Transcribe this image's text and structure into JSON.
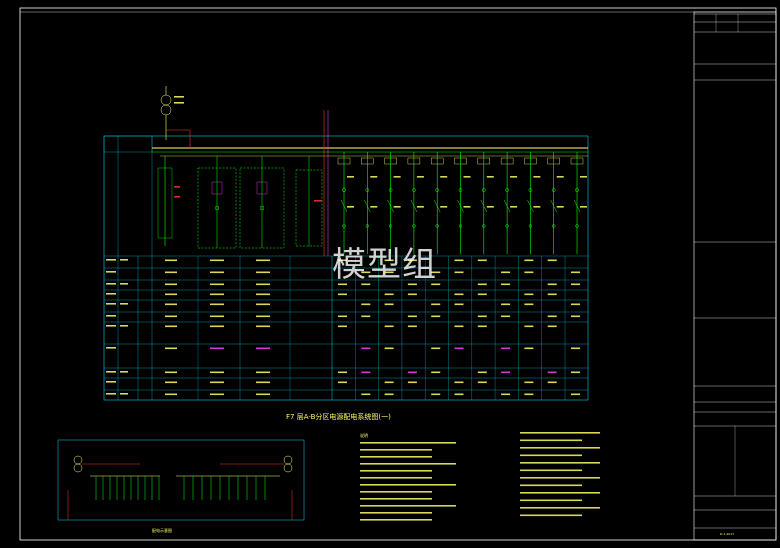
{
  "watermark": "模型组",
  "drawing": {
    "title": "F7 层A-B分区电源配电系统图(一)",
    "inset_caption": "配电示意图",
    "notes_heading": "说明"
  },
  "colors": {
    "background": "#000000",
    "table_lines": "#00b4c8",
    "wire": "#00ff00",
    "text_yellow": "#ffff66",
    "accent_red": "#ff3030",
    "accent_magenta": "#ff40ff",
    "frame": "#ffffff"
  },
  "title_block": {
    "drawing_no": "D-1-2017"
  }
}
